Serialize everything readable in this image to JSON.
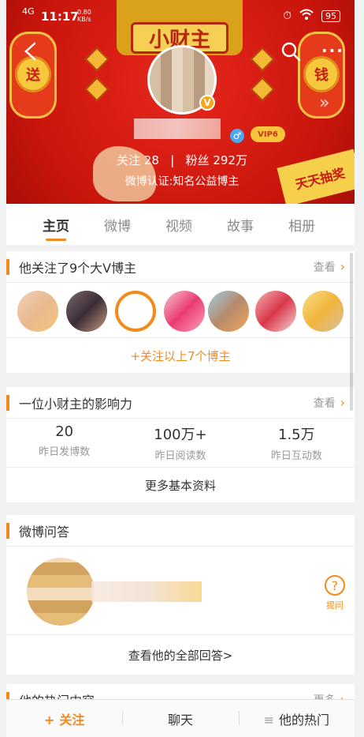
{
  "statusbar": {
    "signal": "4G",
    "time": "11:17",
    "speed": "0.80\nKB/s",
    "battery": "95"
  },
  "banner": {
    "plate_text": "小财主",
    "left_lantern": "送",
    "right_lantern": "钱",
    "ticket_text": "天天抽奖"
  },
  "profile": {
    "follow_label": "关注",
    "follow_count": "28",
    "fans_label": "粉丝",
    "fans_count": "292万",
    "follow_line": "关注 28   |   粉丝 292万",
    "verify": "微博认证:知名公益博主",
    "vip": "VIP6"
  },
  "tabs": [
    "主页",
    "微博",
    "视频",
    "故事",
    "相册"
  ],
  "v_card": {
    "title": "他关注了9个大V博主",
    "more": "查看",
    "follow_all": "+关注以上7个博主"
  },
  "influence_card": {
    "title": "一位小财主的影响力",
    "more": "查看",
    "stats": [
      {
        "num": "20",
        "label": "昨日发博数"
      },
      {
        "num": "100万+",
        "label": "昨日阅读数"
      },
      {
        "num": "1.5万",
        "label": "昨日互动数"
      }
    ],
    "more_info": "更多基本资料"
  },
  "qa_card": {
    "title": "微博问答",
    "ask": "提问",
    "all_answers": "查看他的全部回答>"
  },
  "hot_card": {
    "title": "他的热门内容",
    "more": "更多"
  },
  "bottom_bar": {
    "follow": "关注",
    "chat": "聊天",
    "hot": "他的热门"
  },
  "colors": {
    "accent": "#f28a1c",
    "banner_red": "#d61c10"
  }
}
